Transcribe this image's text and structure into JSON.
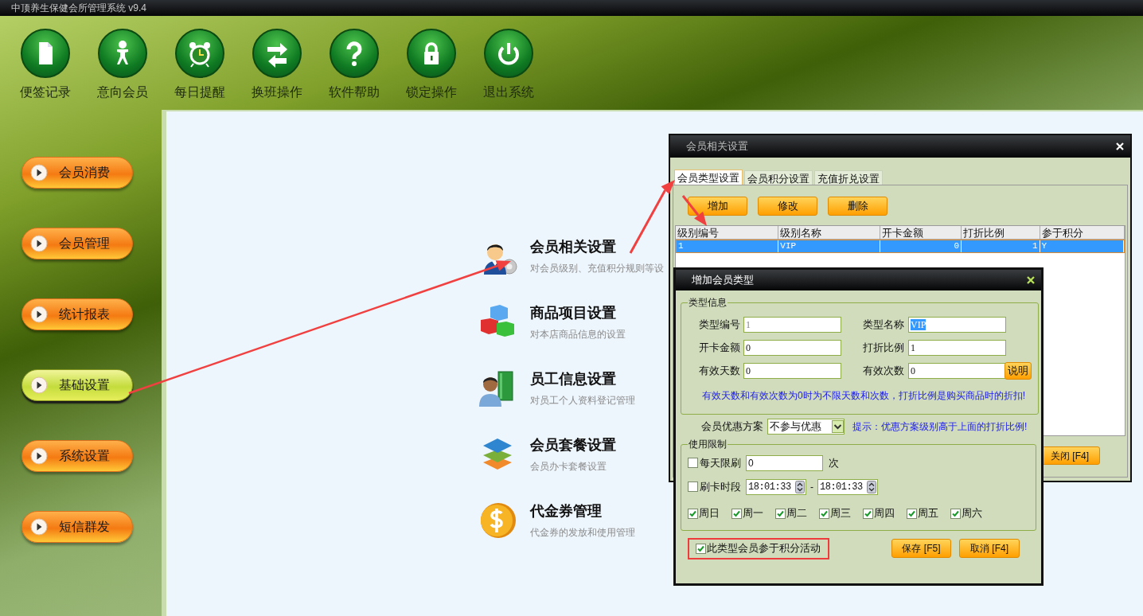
{
  "window": {
    "title": "中顶养生保健会所管理系统 v9.4"
  },
  "toolbar": [
    {
      "label": "便签记录"
    },
    {
      "label": "意向会员"
    },
    {
      "label": "每日提醒"
    },
    {
      "label": "换班操作"
    },
    {
      "label": "软件帮助"
    },
    {
      "label": "锁定操作"
    },
    {
      "label": "退出系统"
    }
  ],
  "sidebar": {
    "items": [
      {
        "label": "会员消费",
        "selected": false
      },
      {
        "label": "会员管理",
        "selected": false
      },
      {
        "label": "统计报表",
        "selected": false
      },
      {
        "label": "基础设置",
        "selected": true
      },
      {
        "label": "系统设置",
        "selected": false
      },
      {
        "label": "短信群发",
        "selected": false
      }
    ]
  },
  "settings_menu": [
    {
      "title": "会员相关设置",
      "description": "对会员级别、充值积分规则等设"
    },
    {
      "title": "商品项目设置",
      "description": "对本店商品信息的设置"
    },
    {
      "title": "员工信息设置",
      "description": "对员工个人资料登记管理"
    },
    {
      "title": "会员套餐设置",
      "description": "会员办卡套餐设置"
    },
    {
      "title": "代金券管理",
      "description": "代金券的发放和使用管理"
    }
  ],
  "member_settings_dialog": {
    "title": "会员相关设置",
    "tabs": [
      {
        "label": "会员类型设置",
        "selected": true
      },
      {
        "label": "会员积分设置",
        "selected": false
      },
      {
        "label": "充值折兑设置",
        "selected": false
      }
    ],
    "buttons": [
      "增加",
      "修改",
      "删除"
    ],
    "table": {
      "columns": [
        "级别编号",
        "级别名称",
        "开卡金额",
        "打折比例",
        "参于积分"
      ],
      "rows": [
        {
          "cells": [
            "1",
            "VIP",
            "0",
            "1",
            "Y"
          ],
          "selected": true
        }
      ]
    },
    "close_button": "关闭 [F4]"
  },
  "add_member_type_dialog": {
    "title": "增加会员类型",
    "type_info": {
      "title": "类型信息",
      "fields": [
        {
          "label": "类型编号",
          "value": "1",
          "disabled": true,
          "text_selected": false
        },
        {
          "label": "类型名称",
          "value": "VIP",
          "disabled": false,
          "text_selected": true
        },
        {
          "label": "开卡金额",
          "value": "0",
          "disabled": false,
          "text_selected": false
        },
        {
          "label": "打折比例",
          "value": "1",
          "disabled": false,
          "text_selected": false
        },
        {
          "label": "有效天数",
          "value": "0",
          "disabled": false,
          "text_selected": false
        },
        {
          "label": "有效次数",
          "value": "0",
          "disabled": false,
          "text_selected": false
        }
      ],
      "explain_button": "说明",
      "note": "有效天数和有效次数为0时为不限天数和次数，打折比例是购买商品时的折扣!"
    },
    "discount_plan": {
      "label": "会员优惠方案",
      "value": "不参与优惠",
      "hint": "提示：优惠方案级别高于上面的打折比例!"
    },
    "usage_limit": {
      "title": "使用限制",
      "daily_limit": {
        "label": "每天限刷",
        "checked": false,
        "value": "0",
        "unit": "次"
      },
      "time_range": {
        "label": "刷卡时段",
        "checked": false,
        "start": "18:01:33",
        "separator": "-",
        "end": "18:01:33"
      },
      "weekdays": [
        {
          "label": "周日",
          "checked": true
        },
        {
          "label": "周一",
          "checked": true
        },
        {
          "label": "周二",
          "checked": true
        },
        {
          "label": "周三",
          "checked": true
        },
        {
          "label": "周四",
          "checked": true
        },
        {
          "label": "周五",
          "checked": true
        },
        {
          "label": "周六",
          "checked": true
        }
      ]
    },
    "points_checkbox": {
      "label": "此类型会员参于积分活动",
      "checked": true
    },
    "save_button": "保存 [F5]",
    "cancel_button": "取消 [F4]"
  }
}
